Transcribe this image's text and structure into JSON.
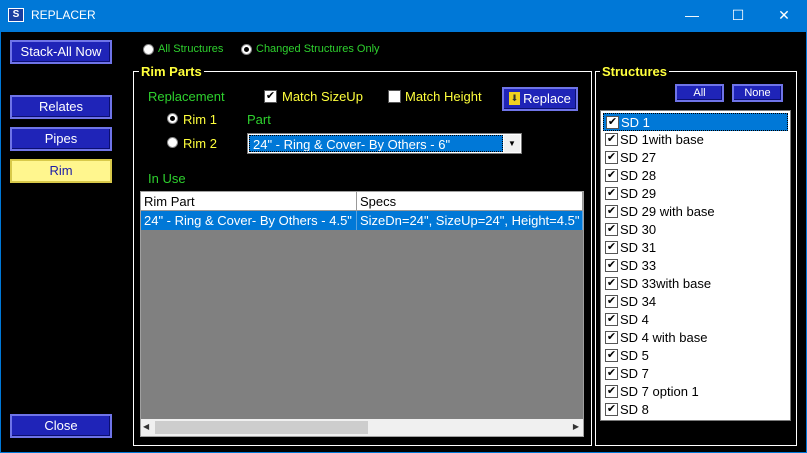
{
  "window": {
    "title": "REPLACER",
    "icon": "S"
  },
  "controls": {
    "minimize": "—",
    "maximize": "☐",
    "close": "✕"
  },
  "left": {
    "stack_all": "Stack-All Now",
    "relates": "Relates",
    "pipes": "Pipes",
    "rim": "Rim",
    "close": "Close"
  },
  "scope": {
    "all": "All Structures",
    "changed": "Changed Structures Only",
    "selected": "changed"
  },
  "rim_parts": {
    "legend": "Rim Parts",
    "replacement_label": "Replacement",
    "match_sizeup": "Match SizeUp",
    "match_sizeup_checked": true,
    "match_height": "Match Height",
    "match_height_checked": false,
    "replace_button": "Replace",
    "rim1": "Rim 1",
    "rim2": "Rim 2",
    "rim_selected": "rim1",
    "part_label": "Part",
    "part_value": "24\" - Ring & Cover- By Others - 6\"",
    "in_use_label": "In Use",
    "table": {
      "columns": [
        "Rim Part",
        "Specs"
      ],
      "rows": [
        [
          "24\" - Ring & Cover- By Others - 4.5\"",
          "SizeDn=24\", SizeUp=24\", Height=4.5\""
        ]
      ]
    }
  },
  "structures": {
    "legend": "Structures",
    "all_button": "All",
    "none_button": "None",
    "items": [
      "SD 1",
      "SD 1with base",
      "SD 27",
      "SD 28",
      "SD 29",
      "SD 29 with base",
      "SD 30",
      "SD 31",
      "SD 33",
      "SD 33with base",
      "SD 34",
      "SD 4",
      "SD 4 with base",
      "SD 5",
      "SD 7",
      "SD 7 option 1",
      "SD 8"
    ],
    "selected_index": 0
  },
  "colors": {
    "titlebar": "#0078d7",
    "button_blue": "#1f24b8",
    "button_yellow": "#fff68e",
    "label_green": "#2ed12e",
    "label_yellow": "#ffff3c"
  }
}
